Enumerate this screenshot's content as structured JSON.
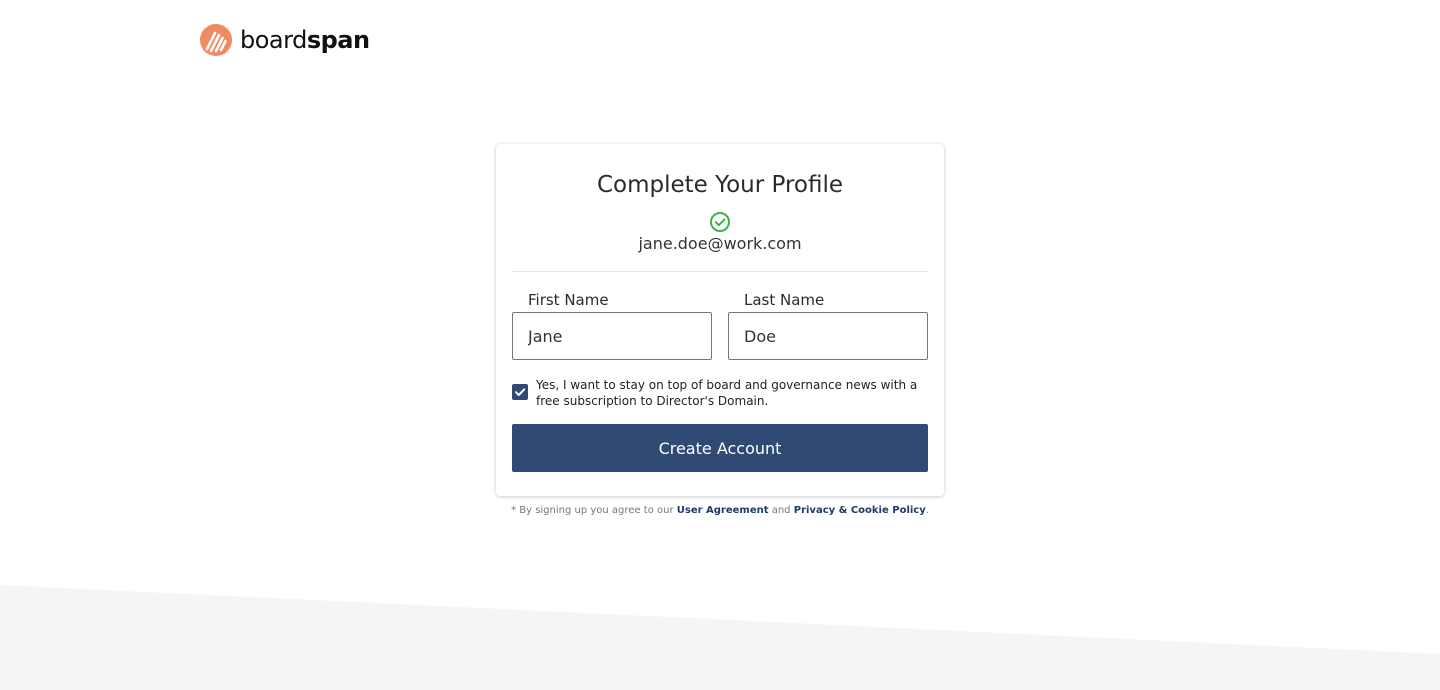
{
  "brand": {
    "name_light": "board",
    "name_bold": "span",
    "logo_color": "#ef8a62",
    "accent_color": "#314a74"
  },
  "card": {
    "title": "Complete Your Profile",
    "verified_icon": "check-circle-icon",
    "verified_color": "#3cb34a",
    "email": "jane.doe@work.com"
  },
  "form": {
    "first_name_label": "First Name",
    "first_name_value": "Jane",
    "last_name_label": "Last Name",
    "last_name_value": "Doe",
    "newsletter_checked": true,
    "newsletter_text": "Yes, I want to stay on top of board and governance news with a free subscription to Director's Domain.",
    "submit_label": "Create Account"
  },
  "footer": {
    "prefix": "* By signing up you agree to our",
    "user_agreement": "User Agreement",
    "conjunction": "and",
    "privacy_policy": "Privacy & Cookie Policy",
    "suffix": "."
  }
}
